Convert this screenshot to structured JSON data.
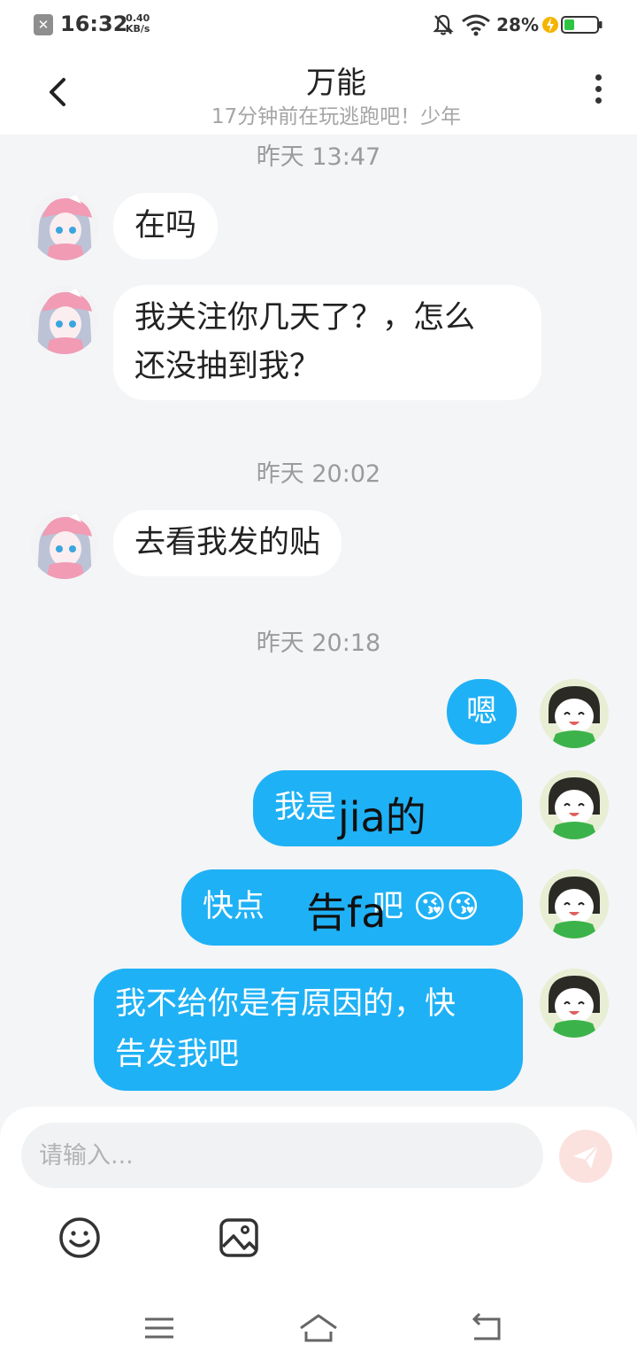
{
  "status_bar": {
    "time": "16:32",
    "speed_value": "0.40",
    "speed_unit": "KB/s",
    "battery_percent": "28%"
  },
  "header": {
    "title": "万能",
    "subtitle": "17分钟前在玩逃跑吧！少年"
  },
  "conversation": {
    "timestamps": [
      "昨天 13:47",
      "昨天 20:02",
      "昨天 20:18"
    ],
    "incoming": [
      {
        "lines": [
          "在吗"
        ]
      },
      {
        "lines": [
          "我关注你几天了？，怎么",
          "还没抽到我？"
        ]
      },
      {
        "lines": [
          "去看我发的贴"
        ]
      }
    ],
    "outgoing": [
      {
        "lines": [
          "嗯"
        ]
      },
      {
        "lines": [
          "我是"
        ],
        "overlay": "jia的"
      },
      {
        "lines": [
          "快点"
        ],
        "tail": "吧",
        "emojis": "😘😘",
        "overlay": "告fa"
      },
      {
        "lines": [
          "我不给你是有原因的，快",
          "告发我吧"
        ]
      }
    ]
  },
  "input": {
    "placeholder": "请输入..."
  },
  "colors": {
    "outgoing_bubble": "#1fb1f5",
    "incoming_bubble": "#ffffff",
    "background": "#f4f5f7",
    "send_button": "#fbe2df"
  },
  "icons": {
    "back": "chevron-left-icon",
    "more": "more-vertical-icon",
    "send": "send-icon",
    "emoji": "smiley-icon",
    "image": "image-icon",
    "nav_menu": "menu-icon",
    "nav_home": "home-icon",
    "nav_back": "back-arrow-icon"
  }
}
